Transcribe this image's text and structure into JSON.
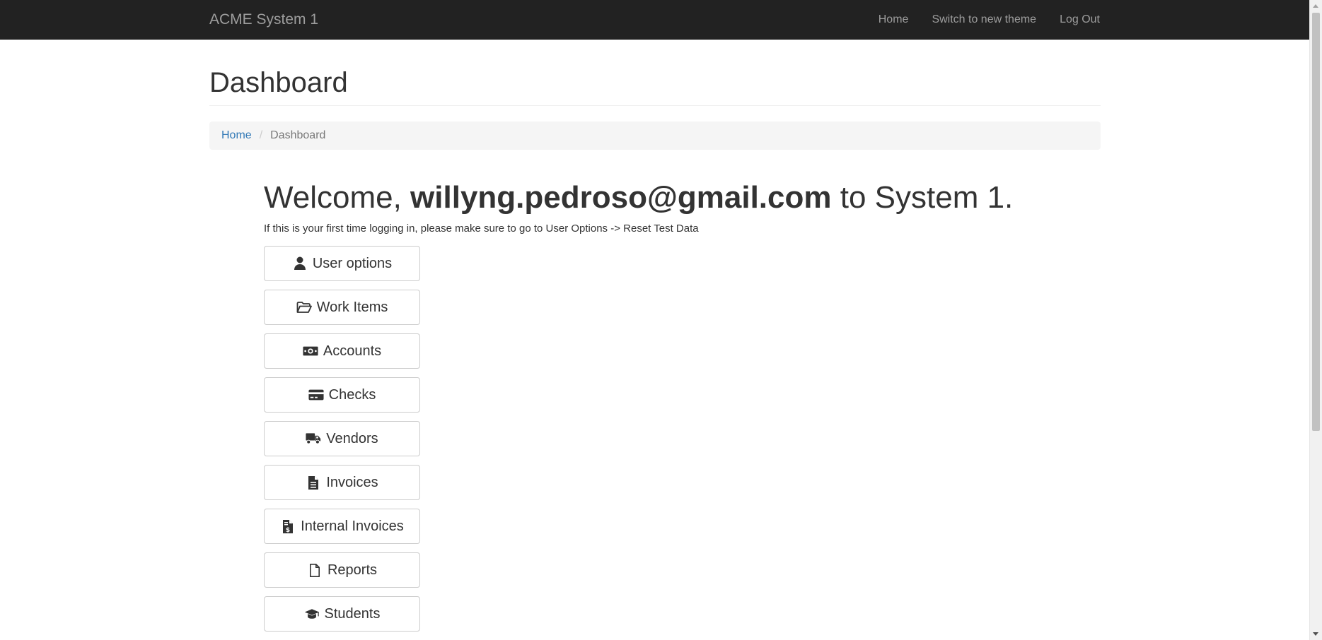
{
  "navbar": {
    "brand": "ACME System 1",
    "links": [
      {
        "label": "Home"
      },
      {
        "label": "Switch to new theme"
      },
      {
        "label": "Log Out"
      }
    ]
  },
  "header": {
    "title": "Dashboard"
  },
  "breadcrumb": {
    "home": "Home",
    "separator": "/",
    "current": "Dashboard"
  },
  "welcome": {
    "prefix": "Welcome,",
    "email": "willyng.pedroso@gmail.com",
    "suffix": "to System 1.",
    "hint": "If this is your first time logging in, please make sure to go to User Options -> Reset Test Data"
  },
  "menu": {
    "items": [
      {
        "label": "User options",
        "icon": "user-icon"
      },
      {
        "label": "Work Items",
        "icon": "folder-open-icon"
      },
      {
        "label": "Accounts",
        "icon": "money-icon"
      },
      {
        "label": "Checks",
        "icon": "credit-card-icon"
      },
      {
        "label": "Vendors",
        "icon": "truck-icon"
      },
      {
        "label": "Invoices",
        "icon": "file-text-icon"
      },
      {
        "label": "Internal Invoices",
        "icon": "file-invoice-dollar-icon"
      },
      {
        "label": "Reports",
        "icon": "file-icon"
      },
      {
        "label": "Students",
        "icon": "graduation-cap-icon"
      }
    ]
  },
  "colors": {
    "navbar_bg": "#222222",
    "navbar_text": "#9d9d9d",
    "link": "#337ab7",
    "breadcrumb_bg": "#f5f5f5"
  }
}
